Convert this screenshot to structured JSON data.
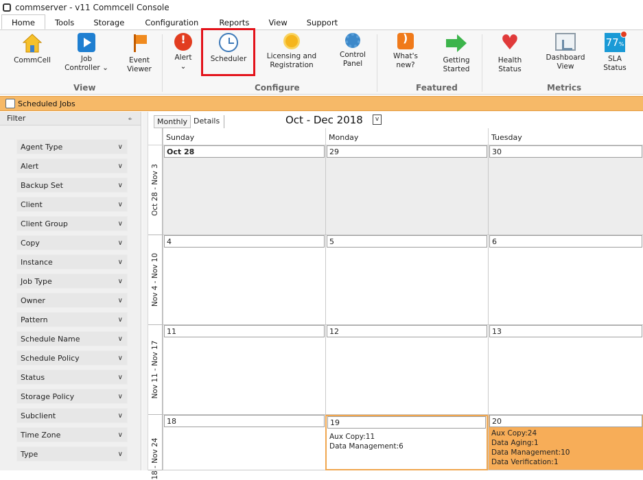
{
  "window": {
    "title": "commserver - v11 Commcell Console"
  },
  "menu": {
    "tabs": [
      "Home",
      "Tools",
      "Storage",
      "Configuration",
      "Reports",
      "View",
      "Support"
    ]
  },
  "ribbon": {
    "buttons": {
      "commcell": "CommCell",
      "job_controller_1": "Job",
      "job_controller_2": "Controller",
      "event_viewer_1": "Event",
      "event_viewer_2": "Viewer",
      "alert": "Alert",
      "scheduler": "Scheduler",
      "licensing_1": "Licensing and",
      "licensing_2": "Registration",
      "control_panel_1": "Control",
      "control_panel_2": "Panel",
      "whats_new_1": "What's",
      "whats_new_2": "new?",
      "getting_started_1": "Getting",
      "getting_started_2": "Started",
      "health_1": "Health",
      "health_2": "Status",
      "dashboard_1": "Dashboard",
      "dashboard_2": "View",
      "sla_1": "SLA",
      "sla_2": "Status",
      "sla_value": "77"
    },
    "groups": {
      "view": "View",
      "configure": "Configure",
      "featured": "Featured",
      "metrics": "Metrics"
    }
  },
  "jobs_bar": {
    "title": "Scheduled Jobs"
  },
  "filter": {
    "title": "Filter",
    "pin": "⍅",
    "items": [
      "Agent Type",
      "Alert",
      "Backup Set",
      "Client",
      "Client Group",
      "Copy",
      "Instance",
      "Job Type",
      "Owner",
      "Pattern",
      "Schedule Name",
      "Schedule Policy",
      "Status",
      "Storage Policy",
      "Subclient",
      "Time Zone",
      "Type"
    ]
  },
  "calendar": {
    "view_tabs": [
      "Monthly",
      "Details"
    ],
    "title": "Oct - Dec 2018",
    "dropdown": "v",
    "days": [
      "Sunday",
      "Monday",
      "Tuesday"
    ],
    "weeks": [
      {
        "label": "Oct 28 - Nov 3",
        "dates": [
          "Oct 28",
          "29",
          "30"
        ]
      },
      {
        "label": "Nov 4 - Nov 10",
        "dates": [
          "4",
          "5",
          "6"
        ]
      },
      {
        "label": "Nov 11 - Nov 17",
        "dates": [
          "11",
          "12",
          "13"
        ]
      },
      {
        "label": "18 - Nov 24",
        "dates": [
          "18",
          "19",
          "20"
        ]
      }
    ],
    "entries": {
      "nov19": [
        "Aux Copy:11",
        "Data Management:6"
      ],
      "nov20": [
        "Aux Copy:24",
        "Data Aging:1",
        "Data Management:10",
        "Data Verification:1"
      ]
    }
  },
  "colors": {
    "highlight_border": "#e3121a",
    "jobs_bar": "#f6b968",
    "busy_day": "#f7ad58"
  }
}
